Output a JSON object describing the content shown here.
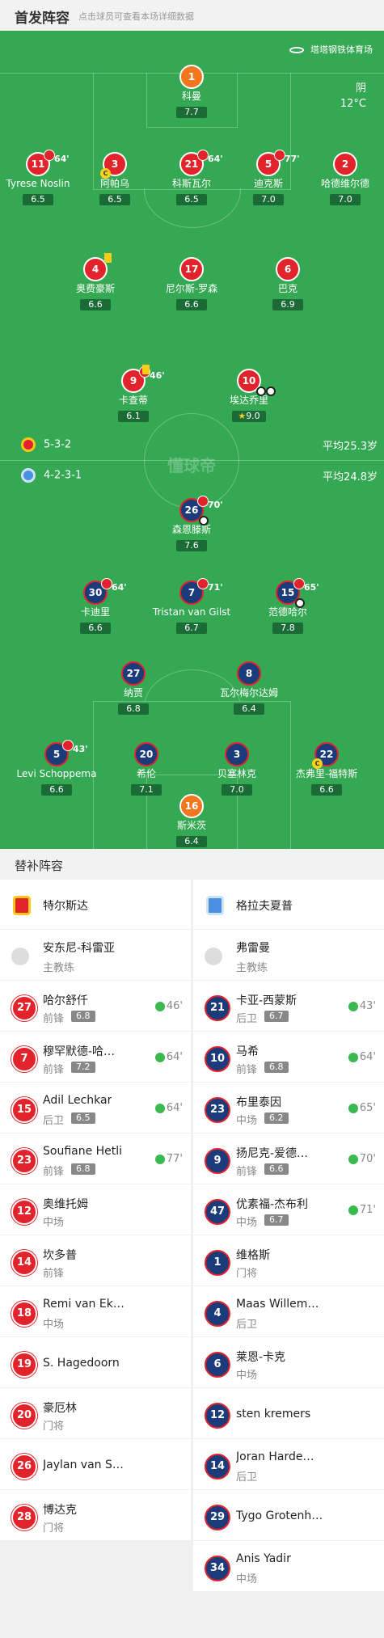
{
  "header": {
    "title": "首发阵容",
    "subtitle": "点击球员可查看本场详细数据"
  },
  "venue": "塔塔钢铁体育场",
  "weather": {
    "condition": "阴",
    "temp": "12°C"
  },
  "watermark": "懂球帝",
  "colors": {
    "pitch": "#35a853",
    "home": "#e2232b",
    "away": "#1c3b7a",
    "gk": "#f2761e"
  },
  "home": {
    "formation": "5-3-2",
    "avg_age": "平均25.3岁",
    "players": [
      {
        "number": "1",
        "name": "科曼",
        "rating": "7.7",
        "gk": true
      },
      {
        "number": "11",
        "name": "Tyrese Noslin",
        "rating": "6.5",
        "sub_off": "64'"
      },
      {
        "number": "3",
        "name": "阿帕乌",
        "rating": "6.5",
        "captain": true
      },
      {
        "number": "21",
        "name": "科斯瓦尔",
        "rating": "6.5",
        "sub_off": "64'"
      },
      {
        "number": "5",
        "name": "迪克斯",
        "rating": "7.0",
        "sub_off": "77'"
      },
      {
        "number": "2",
        "name": "哈德维尔德",
        "rating": "7.0"
      },
      {
        "number": "4",
        "name": "奥费豪斯",
        "rating": "6.6",
        "yellow": true
      },
      {
        "number": "17",
        "name": "尼尔斯-罗森",
        "rating": "6.6"
      },
      {
        "number": "6",
        "name": "巴克",
        "rating": "6.9"
      },
      {
        "number": "9",
        "name": "卡查蒂",
        "rating": "6.1",
        "sub_off": "46'",
        "yellow": true
      },
      {
        "number": "10",
        "name": "埃达乔里",
        "rating": "9.0",
        "star": true,
        "goals": 2
      }
    ]
  },
  "away": {
    "formation": "4-2-3-1",
    "avg_age": "平均24.8岁",
    "players": [
      {
        "number": "26",
        "name": "森恩滕斯",
        "rating": "7.6",
        "sub_off": "70'",
        "goals": 1
      },
      {
        "number": "30",
        "name": "卡迪里",
        "rating": "6.6",
        "sub_off": "64'"
      },
      {
        "number": "7",
        "name": "Tristan van Gilst",
        "rating": "6.7",
        "sub_off": "71'"
      },
      {
        "number": "15",
        "name": "范德哈尔",
        "rating": "7.8",
        "sub_off": "65'",
        "goals": 1
      },
      {
        "number": "27",
        "name": "纳贾",
        "rating": "6.8"
      },
      {
        "number": "8",
        "name": "瓦尔梅尔达姆",
        "rating": "6.4"
      },
      {
        "number": "5",
        "name": "Levi Schoppema",
        "rating": "6.6",
        "sub_off": "43'"
      },
      {
        "number": "20",
        "name": "希伦",
        "rating": "7.1"
      },
      {
        "number": "3",
        "name": "贝塞林克",
        "rating": "7.0"
      },
      {
        "number": "22",
        "name": "杰弗里-福特斯",
        "rating": "6.6",
        "captain": true
      },
      {
        "number": "16",
        "name": "斯米茨",
        "rating": "6.4",
        "gk": true
      }
    ]
  },
  "subs_header": "替补阵容",
  "subs_home": {
    "team": "特尔斯达",
    "coach": {
      "name": "安东尼-科雷亚",
      "role": "主教练"
    },
    "players": [
      {
        "number": "27",
        "name": "哈尔舒仟",
        "pos": "前锋",
        "rating": "6.8",
        "in": "46'"
      },
      {
        "number": "7",
        "name": "穆罕默德-哈…",
        "pos": "前锋",
        "rating": "7.2",
        "in": "64'"
      },
      {
        "number": "15",
        "name": "Adil Lechkar",
        "pos": "后卫",
        "rating": "6.5",
        "in": "64'"
      },
      {
        "number": "23",
        "name": "Soufiane Hetli",
        "pos": "前锋",
        "rating": "6.8",
        "in": "77'"
      },
      {
        "number": "12",
        "name": "奥维托姆",
        "pos": "中场"
      },
      {
        "number": "14",
        "name": "坎多普",
        "pos": "前锋"
      },
      {
        "number": "18",
        "name": "Remi van Ek…",
        "pos": "中场"
      },
      {
        "number": "19",
        "name": "S. Hagedoorn",
        "pos": ""
      },
      {
        "number": "20",
        "name": "豪厄林",
        "pos": "门将"
      },
      {
        "number": "26",
        "name": "Jaylan van S…",
        "pos": ""
      },
      {
        "number": "28",
        "name": "博达克",
        "pos": "门将"
      }
    ]
  },
  "subs_away": {
    "team": "格拉夫夏普",
    "coach": {
      "name": "弗雷曼",
      "role": "主教练"
    },
    "players": [
      {
        "number": "21",
        "name": "卡亚-西蒙斯",
        "pos": "后卫",
        "rating": "6.7",
        "in": "43'"
      },
      {
        "number": "10",
        "name": "马希",
        "pos": "前锋",
        "rating": "6.8",
        "in": "64'"
      },
      {
        "number": "23",
        "name": "布里泰因",
        "pos": "中场",
        "rating": "6.2",
        "in": "65'"
      },
      {
        "number": "9",
        "name": "扬尼克-爱德…",
        "pos": "前锋",
        "rating": "6.6",
        "in": "70'"
      },
      {
        "number": "47",
        "name": "优素福-杰布利",
        "pos": "中场",
        "rating": "6.7",
        "in": "71'"
      },
      {
        "number": "1",
        "name": "维格斯",
        "pos": "门将"
      },
      {
        "number": "4",
        "name": "Maas Willem…",
        "pos": "后卫"
      },
      {
        "number": "6",
        "name": "莱恩-卡克",
        "pos": "中场"
      },
      {
        "number": "12",
        "name": "sten kremers",
        "pos": ""
      },
      {
        "number": "14",
        "name": "Joran Harde…",
        "pos": "后卫"
      },
      {
        "number": "29",
        "name": "Tygo Grotenh…",
        "pos": ""
      },
      {
        "number": "34",
        "name": "Anis Yadir",
        "pos": "中场"
      }
    ]
  }
}
